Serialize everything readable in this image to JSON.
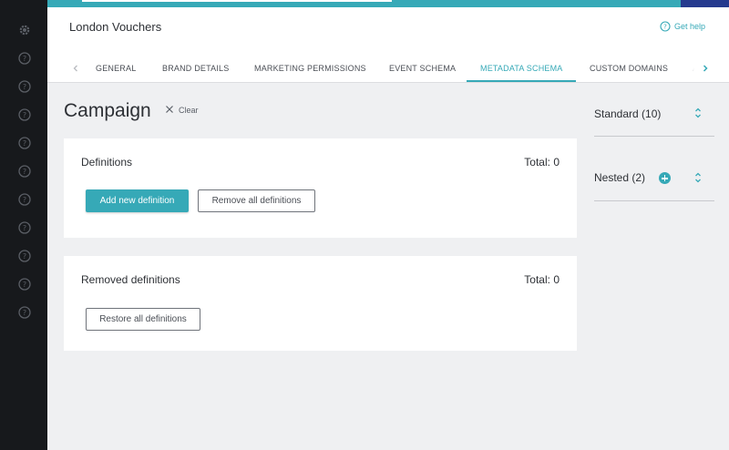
{
  "header": {
    "title": "London Vouchers",
    "help_label": "Get help"
  },
  "tabs": [
    {
      "label": "GENERAL"
    },
    {
      "label": "BRAND DETAILS"
    },
    {
      "label": "MARKETING PERMISSIONS"
    },
    {
      "label": "EVENT SCHEMA"
    },
    {
      "label": "METADATA SCHEMA",
      "active": true
    },
    {
      "label": "CUSTOM DOMAINS"
    },
    {
      "label": "A"
    }
  ],
  "page": {
    "title": "Campaign",
    "clear_label": "Clear"
  },
  "definitions": {
    "title": "Definitions",
    "total": "Total: 0",
    "add_label": "Add new definition",
    "remove_label": "Remove all definitions"
  },
  "removed": {
    "title": "Removed definitions",
    "total": "Total: 0",
    "restore_label": "Restore all definitions"
  },
  "side": {
    "standard_label": "Standard (10)",
    "nested_label": "Nested (2)"
  },
  "rail": {
    "icons": [
      "gear-icon",
      "help-icon",
      "help-icon",
      "help-icon",
      "help-icon",
      "help-icon",
      "help-icon",
      "help-icon",
      "help-icon",
      "help-icon",
      "help-icon"
    ]
  },
  "colors": {
    "accent": "#36a9b7",
    "rail": "#17191c",
    "brand_navy": "#253a8e"
  }
}
